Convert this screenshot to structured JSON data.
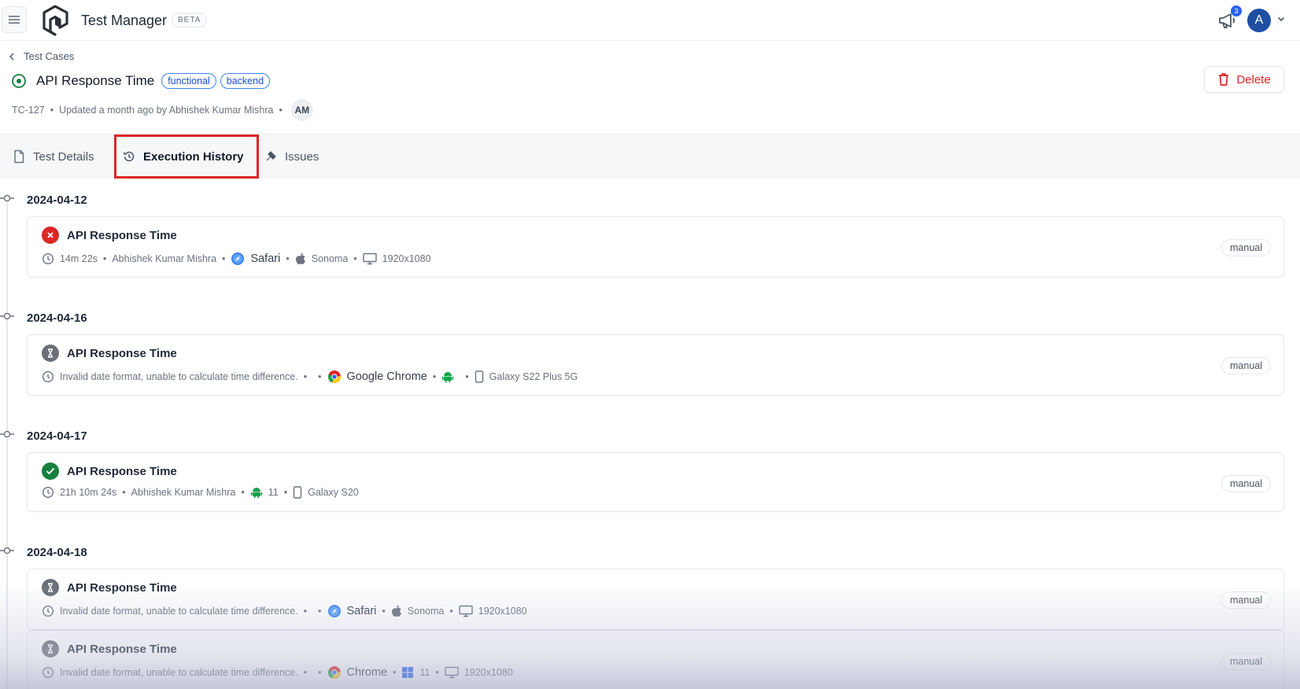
{
  "app": {
    "title": "Test Manager",
    "beta_label": "BETA",
    "notification_count": "3",
    "avatar_initial": "A"
  },
  "breadcrumb": {
    "label": "Test Cases"
  },
  "test_case": {
    "title": "API Response Time",
    "tags": [
      "functional",
      "backend"
    ],
    "id": "TC-127",
    "updated_text": "Updated a month ago by Abhishek Kumar Mishra",
    "author_initials": "AM",
    "delete_label": "Delete"
  },
  "tabs": [
    {
      "label": "Test Details",
      "icon": "file-icon"
    },
    {
      "label": "Execution History",
      "icon": "history-icon",
      "active": true
    },
    {
      "label": "Issues",
      "icon": "bug-icon"
    }
  ],
  "colors": {
    "accent": "#1d4ed8",
    "danger": "#dc2626",
    "success": "#15803d",
    "pending": "#6b6f76"
  },
  "executions": [
    {
      "date": "2024-04-12",
      "title": "API Response Time",
      "status": "failed",
      "duration": "14m 22s",
      "user": "Abhishek Kumar Mishra",
      "browser": "Safari",
      "os": "Sonoma",
      "device": "1920x1080",
      "mode": "manual"
    },
    {
      "date": "2024-04-16",
      "title": "API Response Time",
      "status": "pending",
      "duration": "Invalid date format, unable to calculate time difference.",
      "user": "",
      "browser": "Google Chrome",
      "os": "",
      "device": "Galaxy S22 Plus 5G",
      "mode": "manual"
    },
    {
      "date": "2024-04-17",
      "title": "API Response Time",
      "status": "passed",
      "duration": "21h 10m 24s",
      "user": "Abhishek Kumar Mishra",
      "browser": "",
      "os": "11",
      "device": "Galaxy S20",
      "mode": "manual"
    },
    {
      "date": "2024-04-18",
      "title": "API Response Time",
      "status": "pending",
      "duration": "Invalid date format, unable to calculate time difference.",
      "user": "",
      "browser": "Safari",
      "os": "Sonoma",
      "device": "1920x1080",
      "mode": "manual"
    },
    {
      "date": "",
      "title": "API Response Time",
      "status": "pending",
      "duration": "Invalid date format, unable to calculate time difference.",
      "user": "",
      "browser": "Chrome",
      "os": "11",
      "device": "1920x1080",
      "mode": "manual"
    }
  ]
}
